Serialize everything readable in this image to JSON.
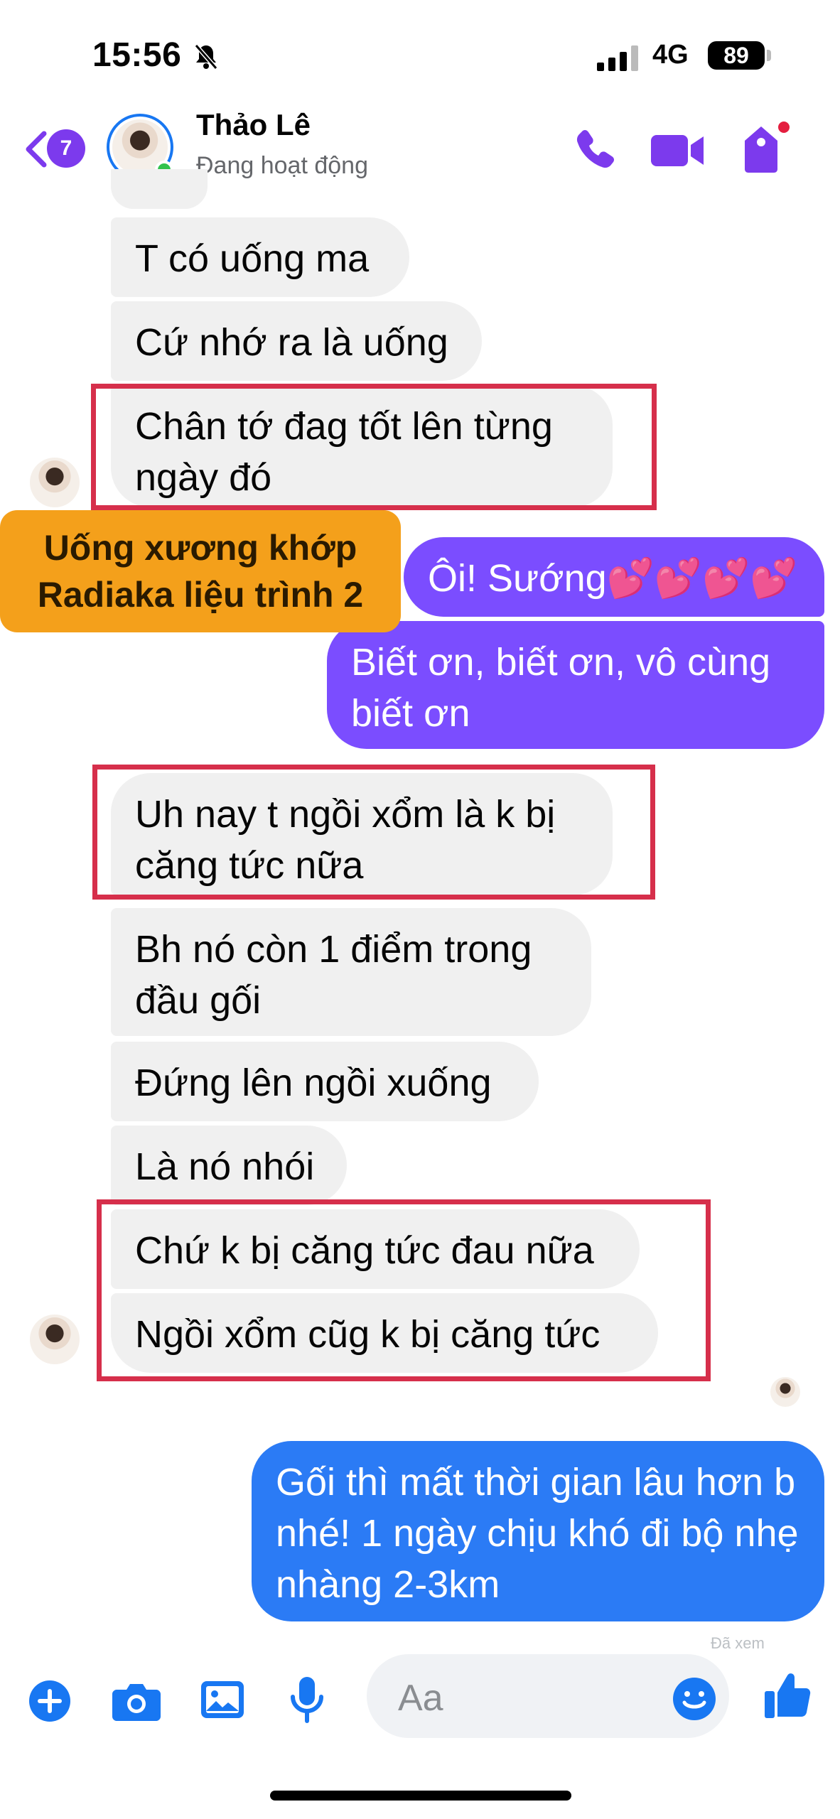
{
  "status_bar": {
    "time": "15:56",
    "network": "4G",
    "battery": "89"
  },
  "header": {
    "unread_count": "7",
    "contact_name": "Thảo Lê",
    "contact_status": "Đang hoạt động"
  },
  "messages": [
    {
      "text": "T có uống ma"
    },
    {
      "text": "Cứ nhớ ra là uống"
    },
    {
      "text": "Chân tớ đag tốt lên từng ngày đó"
    },
    {
      "text": "Ôi! Sướng💕💕💕💕"
    },
    {
      "text": "Biết ơn, biết ơn, vô cùng biết ơn"
    },
    {
      "text": "Uh nay t ngồi xổm là k bị căng tức nữa"
    },
    {
      "text": "Bh nó còn 1 điểm trong đầu gối"
    },
    {
      "text": "Đứng lên ngồi xuống"
    },
    {
      "text": "Là nó nhói"
    },
    {
      "text": "Chứ k bị căng tức đau nữa"
    },
    {
      "text": "Ngồi xổm cũg k bị căng tức"
    },
    {
      "text": "Gối thì mất thời gian lâu hơn b nhé! 1 ngày chịu khó đi bộ nhẹ nhàng 2-3km"
    }
  ],
  "overlay_label": {
    "line1": "Uống xương khớp",
    "line2": "Radiaka liệu trình 2"
  },
  "seen_text": "Đã xem",
  "composer": {
    "placeholder": "Aa"
  },
  "icons": [
    "back-icon",
    "phone-icon",
    "video-icon",
    "tag-icon",
    "plus-icon",
    "camera-icon",
    "image-icon",
    "mic-icon",
    "emoji-icon",
    "like-icon"
  ],
  "colors": {
    "accent": "#7c3aed",
    "outgoing_purple": "#7b4dff",
    "outgoing_blue": "#2b7bf5",
    "incoming": "#f0f0f0",
    "highlight_box": "#d62f4b",
    "label": "#f4a01b",
    "icon_blue": "#1877f2"
  }
}
